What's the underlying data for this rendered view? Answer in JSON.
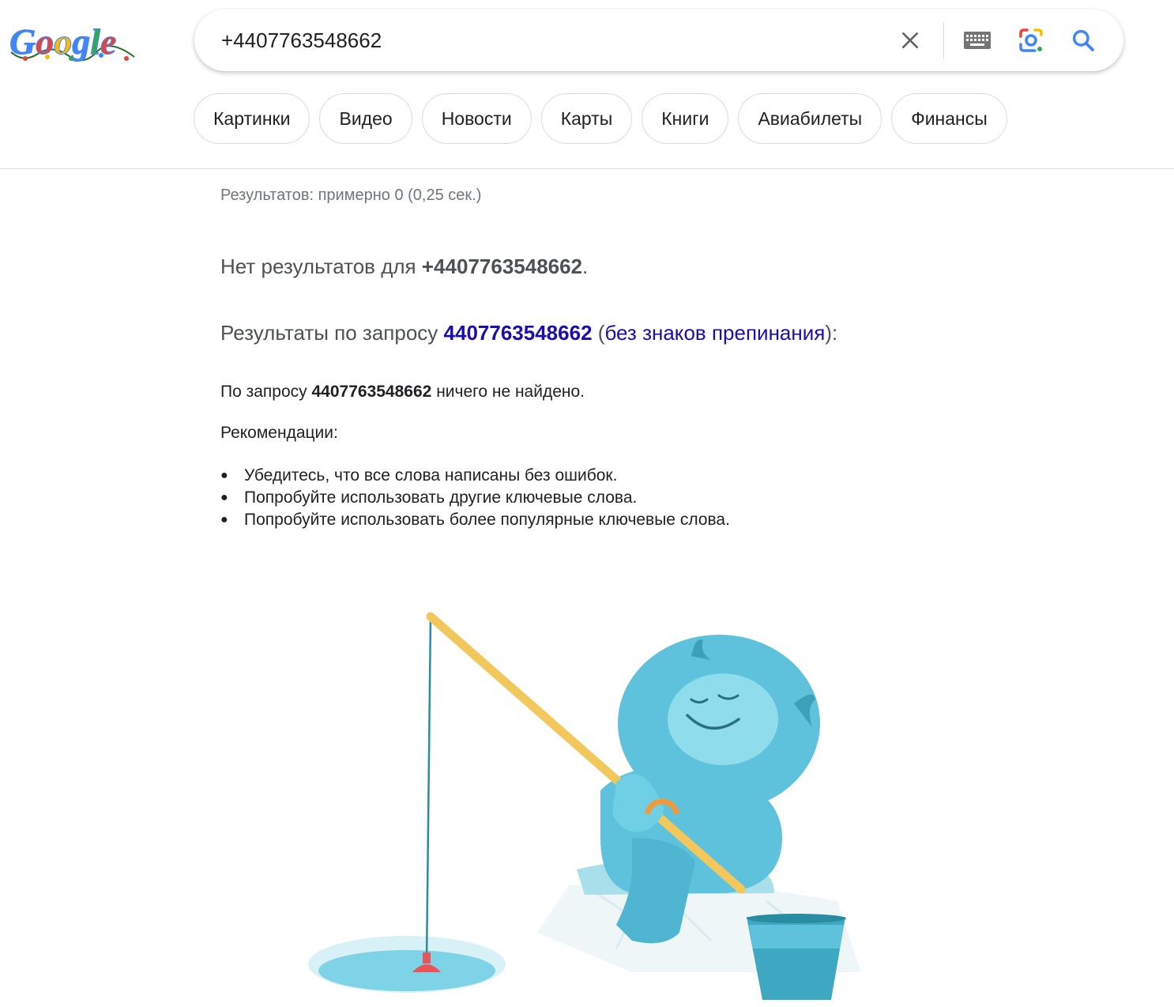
{
  "logo": {
    "text": "Google",
    "variant": "festive-doodle"
  },
  "search": {
    "query": "+4407763548662",
    "icons": [
      "close-icon",
      "keyboard-icon",
      "lens-icon",
      "search-icon"
    ],
    "accent": "#4285f4"
  },
  "chips": [
    "Картинки",
    "Видео",
    "Новости",
    "Карты",
    "Книги",
    "Авиабилеты",
    "Финансы"
  ],
  "results": {
    "stats": "Результатов: примерно 0 (0,25 сек.)",
    "no_results_prefix": "Нет результатов для",
    "no_results_query": "+4407763548662",
    "no_results_suffix": ".",
    "showing_prefix": "Результаты по запросу",
    "showing_query": "4407763548662",
    "showing_open": "(",
    "showing_link": "без знаков препинания",
    "showing_close": "):",
    "didnt_prefix": "По запросу",
    "didnt_query": "4407763548662",
    "didnt_suffix": "ничего не найдено.",
    "recommendations_title": "Рекомендации:",
    "tips": [
      "Убедитесь, что все слова написаны без ошибок.",
      "Попробуйте использовать другие ключевые слова.",
      "Попробуйте использовать более популярные ключевые слова."
    ]
  },
  "colors": {
    "link": "#1a0dab",
    "body_text": "#202124",
    "muted": "#70757a",
    "border": "#dadce0"
  }
}
